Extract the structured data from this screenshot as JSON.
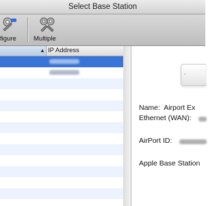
{
  "window": {
    "title": "Select Base Station"
  },
  "toolbar": {
    "items": [
      {
        "label": "figure",
        "icon": "configure-icon"
      },
      {
        "label": "Multiple",
        "icon": "multiple-icon"
      }
    ]
  },
  "list": {
    "columns": [
      {
        "label": "",
        "sorted": true,
        "sort_indicator": "▲"
      },
      {
        "label": "IP Address"
      }
    ],
    "selected_index": 0,
    "rows": [
      {
        "ip_address_obscured": true
      },
      {
        "ip_address_obscured": true
      }
    ],
    "colors": {
      "selection": "#3875d7",
      "alternate_row": "#edf3fe"
    }
  },
  "detail": {
    "device_icon": "airport-express-icon",
    "name_label": "Name:",
    "name_value": "Airport Ex",
    "wan_label": "Ethernet (WAN):",
    "airport_id_label": "AirPort ID:",
    "model_text": "Apple Base Station"
  }
}
